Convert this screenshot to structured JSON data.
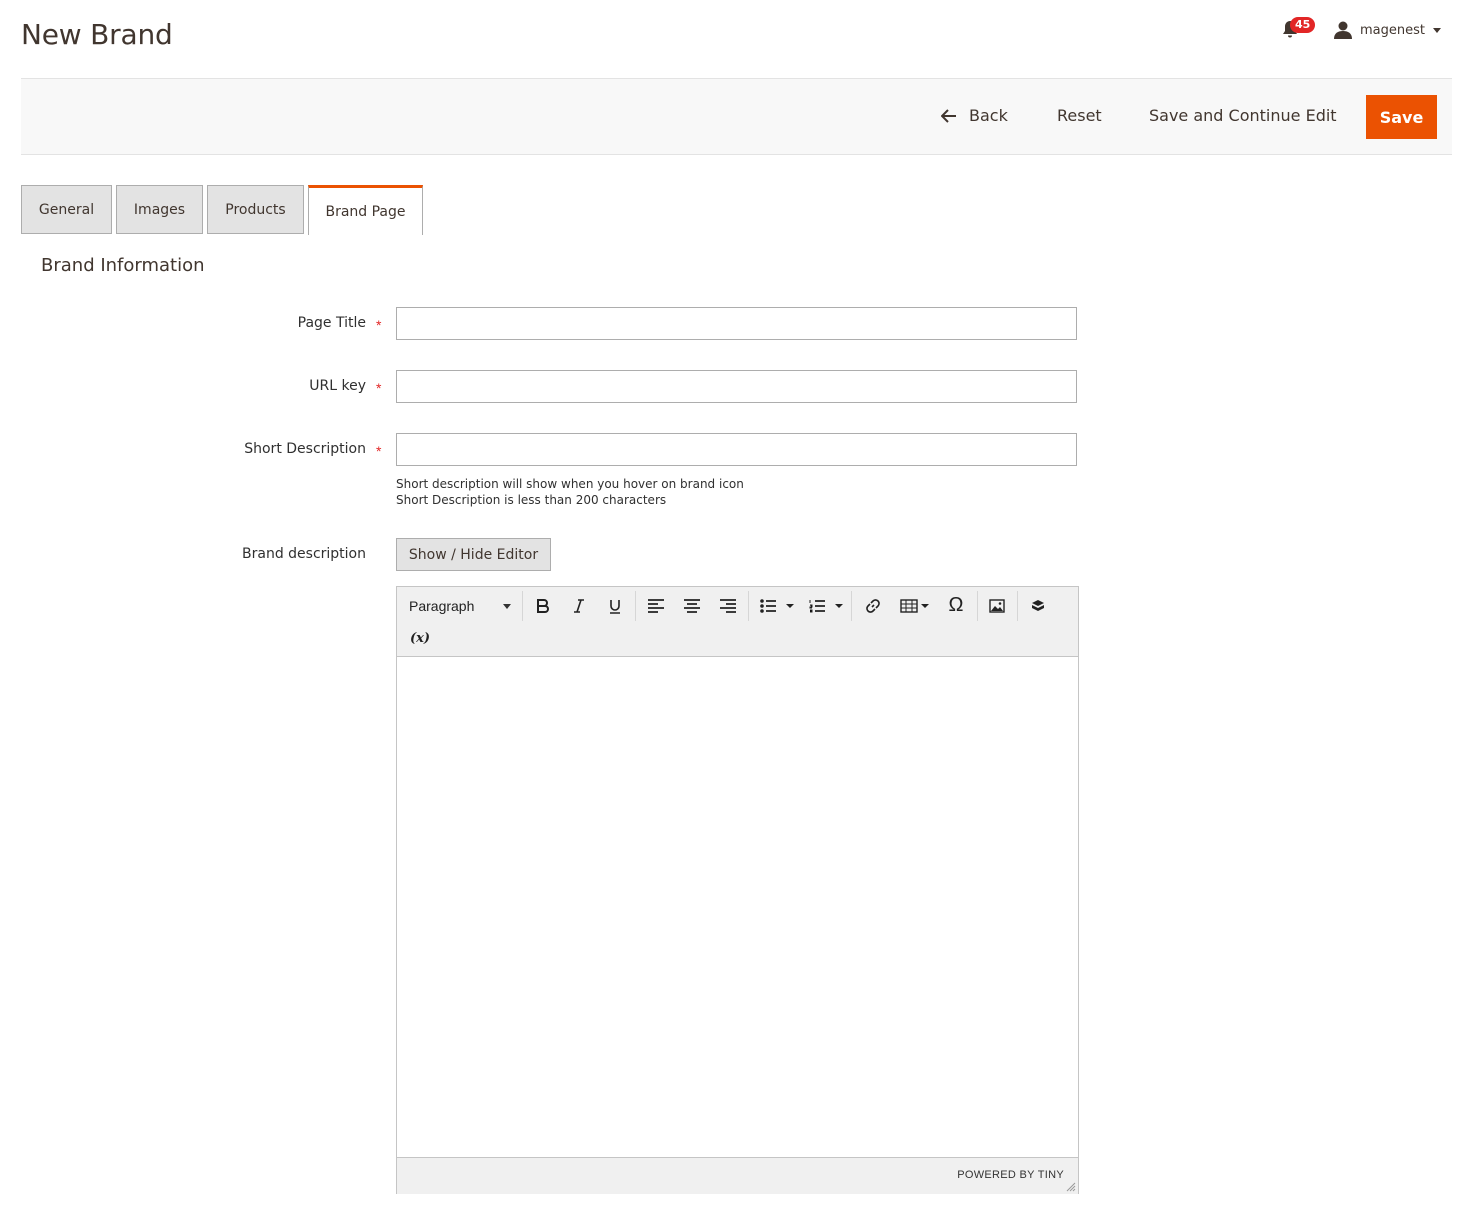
{
  "header": {
    "title": "New Brand",
    "notifications_count": "45",
    "username": "magenest"
  },
  "actions": {
    "back_label": "Back",
    "reset_label": "Reset",
    "save_continue_label": "Save and Continue Edit",
    "save_label": "Save"
  },
  "tabs": [
    {
      "label": "General",
      "active": false
    },
    {
      "label": "Images",
      "active": false
    },
    {
      "label": "Products",
      "active": false
    },
    {
      "label": "Brand Page",
      "active": true
    }
  ],
  "section": {
    "title": "Brand Information"
  },
  "fields": {
    "page_title": {
      "label": "Page Title",
      "value": "",
      "required": "*"
    },
    "url_key": {
      "label": "URL key",
      "value": "",
      "required": "*"
    },
    "short_description": {
      "label": "Short Description",
      "value": "",
      "required": "*",
      "note_line1": "Short description will show when you hover on brand icon",
      "note_line2": "Short Description is less than 200 characters"
    },
    "brand_description": {
      "label": "Brand description"
    }
  },
  "editor": {
    "toggle_label": "Show / Hide Editor",
    "format_select": "Paragraph",
    "variable_label": "(x)",
    "powered_by": "POWERED BY TINY",
    "tools": [
      "bold-icon",
      "italic-icon",
      "underline-icon",
      "align-left-icon",
      "align-center-icon",
      "align-right-icon",
      "bullet-list-icon",
      "numbered-list-icon",
      "link-icon",
      "table-icon",
      "special-char-icon",
      "image-icon",
      "widget-icon",
      "variable-icon"
    ]
  },
  "colors": {
    "accent": "#eb5202",
    "badge": "#e22626",
    "required": "#e22626"
  }
}
